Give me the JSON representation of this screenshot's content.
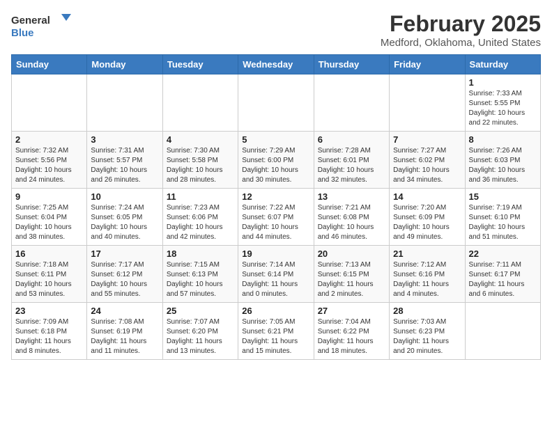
{
  "header": {
    "logo_general": "General",
    "logo_blue": "Blue",
    "month_year": "February 2025",
    "location": "Medford, Oklahoma, United States"
  },
  "weekdays": [
    "Sunday",
    "Monday",
    "Tuesday",
    "Wednesday",
    "Thursday",
    "Friday",
    "Saturday"
  ],
  "weeks": [
    [
      {
        "day": "",
        "info": ""
      },
      {
        "day": "",
        "info": ""
      },
      {
        "day": "",
        "info": ""
      },
      {
        "day": "",
        "info": ""
      },
      {
        "day": "",
        "info": ""
      },
      {
        "day": "",
        "info": ""
      },
      {
        "day": "1",
        "info": "Sunrise: 7:33 AM\nSunset: 5:55 PM\nDaylight: 10 hours\nand 22 minutes."
      }
    ],
    [
      {
        "day": "2",
        "info": "Sunrise: 7:32 AM\nSunset: 5:56 PM\nDaylight: 10 hours\nand 24 minutes."
      },
      {
        "day": "3",
        "info": "Sunrise: 7:31 AM\nSunset: 5:57 PM\nDaylight: 10 hours\nand 26 minutes."
      },
      {
        "day": "4",
        "info": "Sunrise: 7:30 AM\nSunset: 5:58 PM\nDaylight: 10 hours\nand 28 minutes."
      },
      {
        "day": "5",
        "info": "Sunrise: 7:29 AM\nSunset: 6:00 PM\nDaylight: 10 hours\nand 30 minutes."
      },
      {
        "day": "6",
        "info": "Sunrise: 7:28 AM\nSunset: 6:01 PM\nDaylight: 10 hours\nand 32 minutes."
      },
      {
        "day": "7",
        "info": "Sunrise: 7:27 AM\nSunset: 6:02 PM\nDaylight: 10 hours\nand 34 minutes."
      },
      {
        "day": "8",
        "info": "Sunrise: 7:26 AM\nSunset: 6:03 PM\nDaylight: 10 hours\nand 36 minutes."
      }
    ],
    [
      {
        "day": "9",
        "info": "Sunrise: 7:25 AM\nSunset: 6:04 PM\nDaylight: 10 hours\nand 38 minutes."
      },
      {
        "day": "10",
        "info": "Sunrise: 7:24 AM\nSunset: 6:05 PM\nDaylight: 10 hours\nand 40 minutes."
      },
      {
        "day": "11",
        "info": "Sunrise: 7:23 AM\nSunset: 6:06 PM\nDaylight: 10 hours\nand 42 minutes."
      },
      {
        "day": "12",
        "info": "Sunrise: 7:22 AM\nSunset: 6:07 PM\nDaylight: 10 hours\nand 44 minutes."
      },
      {
        "day": "13",
        "info": "Sunrise: 7:21 AM\nSunset: 6:08 PM\nDaylight: 10 hours\nand 46 minutes."
      },
      {
        "day": "14",
        "info": "Sunrise: 7:20 AM\nSunset: 6:09 PM\nDaylight: 10 hours\nand 49 minutes."
      },
      {
        "day": "15",
        "info": "Sunrise: 7:19 AM\nSunset: 6:10 PM\nDaylight: 10 hours\nand 51 minutes."
      }
    ],
    [
      {
        "day": "16",
        "info": "Sunrise: 7:18 AM\nSunset: 6:11 PM\nDaylight: 10 hours\nand 53 minutes."
      },
      {
        "day": "17",
        "info": "Sunrise: 7:17 AM\nSunset: 6:12 PM\nDaylight: 10 hours\nand 55 minutes."
      },
      {
        "day": "18",
        "info": "Sunrise: 7:15 AM\nSunset: 6:13 PM\nDaylight: 10 hours\nand 57 minutes."
      },
      {
        "day": "19",
        "info": "Sunrise: 7:14 AM\nSunset: 6:14 PM\nDaylight: 11 hours\nand 0 minutes."
      },
      {
        "day": "20",
        "info": "Sunrise: 7:13 AM\nSunset: 6:15 PM\nDaylight: 11 hours\nand 2 minutes."
      },
      {
        "day": "21",
        "info": "Sunrise: 7:12 AM\nSunset: 6:16 PM\nDaylight: 11 hours\nand 4 minutes."
      },
      {
        "day": "22",
        "info": "Sunrise: 7:11 AM\nSunset: 6:17 PM\nDaylight: 11 hours\nand 6 minutes."
      }
    ],
    [
      {
        "day": "23",
        "info": "Sunrise: 7:09 AM\nSunset: 6:18 PM\nDaylight: 11 hours\nand 8 minutes."
      },
      {
        "day": "24",
        "info": "Sunrise: 7:08 AM\nSunset: 6:19 PM\nDaylight: 11 hours\nand 11 minutes."
      },
      {
        "day": "25",
        "info": "Sunrise: 7:07 AM\nSunset: 6:20 PM\nDaylight: 11 hours\nand 13 minutes."
      },
      {
        "day": "26",
        "info": "Sunrise: 7:05 AM\nSunset: 6:21 PM\nDaylight: 11 hours\nand 15 minutes."
      },
      {
        "day": "27",
        "info": "Sunrise: 7:04 AM\nSunset: 6:22 PM\nDaylight: 11 hours\nand 18 minutes."
      },
      {
        "day": "28",
        "info": "Sunrise: 7:03 AM\nSunset: 6:23 PM\nDaylight: 11 hours\nand 20 minutes."
      },
      {
        "day": "",
        "info": ""
      }
    ]
  ]
}
